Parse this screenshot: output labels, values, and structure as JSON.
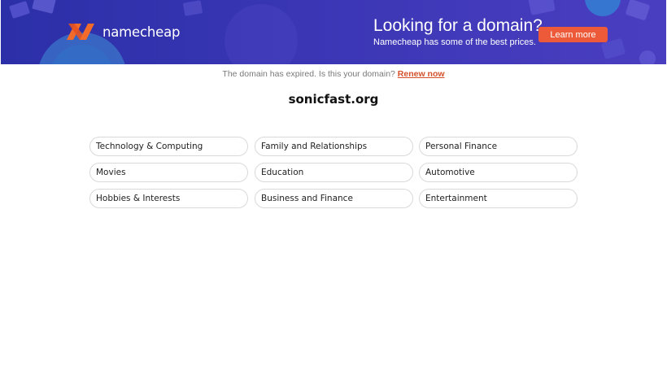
{
  "banner": {
    "brand_name": "namecheap",
    "promo_title": "Looking for a domain?",
    "promo_subtitle": "Namecheap has some of the best prices.",
    "cta_label": "Learn more",
    "colors": {
      "banner_bg": "#3a36b4",
      "logo_orange": "#f26b2a",
      "cta_bg": "#ec5a3a"
    }
  },
  "notice": {
    "text": "The domain has expired. Is this your domain?",
    "link_label": "Renew now"
  },
  "domain": {
    "name": "sonicfast.org"
  },
  "categories": [
    "Technology & Computing",
    "Family and Relationships",
    "Personal Finance",
    "Movies",
    "Education",
    "Automotive",
    "Hobbies & Interests",
    "Business and Finance",
    "Entertainment"
  ]
}
